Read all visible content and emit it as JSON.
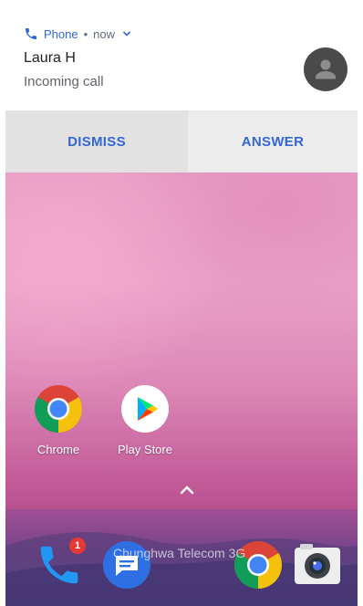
{
  "notification": {
    "app_name": "Phone",
    "separator": "•",
    "time": "now",
    "caller": "Laura H",
    "status": "Incoming call",
    "phone_icon": "phone-icon",
    "avatar_icon": "person-icon"
  },
  "actions": {
    "dismiss": "DISMISS",
    "answer": "ANSWER"
  },
  "home": {
    "apps": [
      {
        "label": "Chrome",
        "icon": "chrome-icon"
      },
      {
        "label": "Play Store",
        "icon": "play-store-icon"
      }
    ],
    "app_drawer_icon": "chevron-up-icon"
  },
  "dock": {
    "carrier": "Chunghwa Telecom 3G",
    "phone_badge": "1",
    "icons": [
      "phone-icon",
      "messages-icon",
      "chrome-icon",
      "camera-icon"
    ]
  },
  "colors": {
    "accent": "#3367d6",
    "dismiss_bg": "#e2e2e2",
    "answer_bg": "#ececec",
    "badge": "#e53935"
  }
}
